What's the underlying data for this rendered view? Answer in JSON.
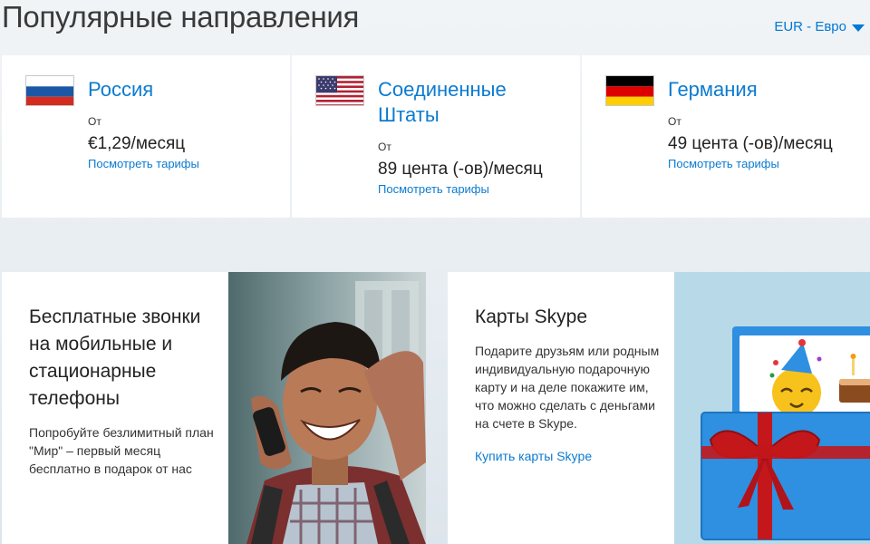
{
  "header": {
    "title": "Популярные направления",
    "currency": "EUR - Евро"
  },
  "destinations": [
    {
      "name": "Россия",
      "from": "От",
      "price": "€1,29/месяц",
      "link": "Посмотреть тарифы"
    },
    {
      "name": "Соединенные Штаты",
      "from": "От",
      "price": "89 цента (-ов)/месяц",
      "link": "Посмотреть тарифы"
    },
    {
      "name": "Германия",
      "from": "От",
      "price": "49 цента (-ов)/месяц",
      "link": "Посмотреть тарифы"
    }
  ],
  "promo_free_calls": {
    "title": "Бесплатные звонки на мобильные и стационарные телефоны",
    "description": "Попробуйте безлимитный план \"Мир\" – первый месяц бесплатно в подарок от нас"
  },
  "promo_cards": {
    "title": "Карты Skype",
    "description": "Подарите друзьям или родным индивидуальную подарочную карту и на деле покажите им, что можно сделать с деньгами на счете в Skype.",
    "link": "Купить карты Skype"
  },
  "colors": {
    "accent": "#0078d4",
    "link": "#0b7bd0",
    "gift_blue": "#2f8fe0",
    "ribbon": "#c4171b"
  }
}
